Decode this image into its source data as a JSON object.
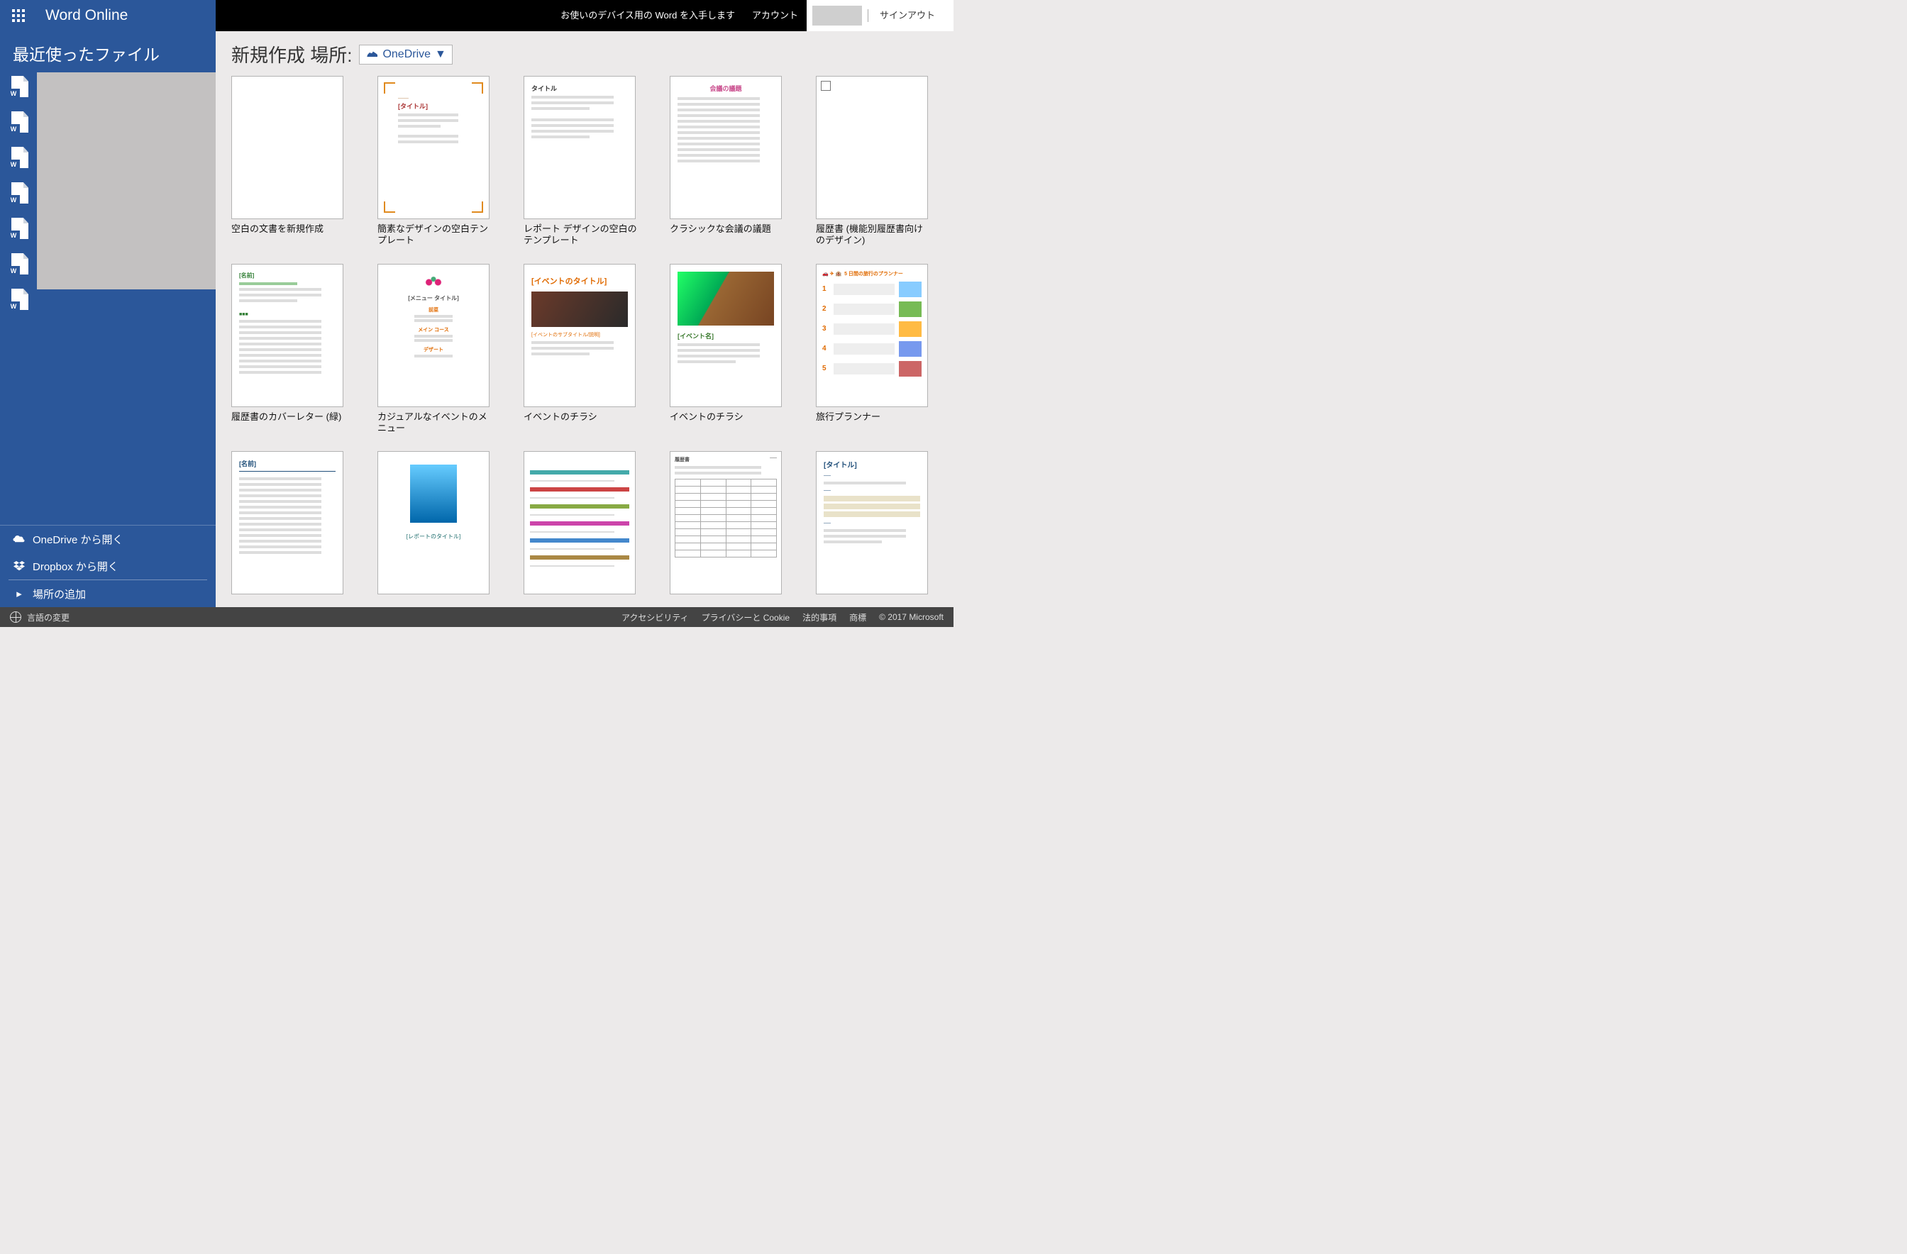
{
  "header": {
    "brand": "Word Online",
    "get_word": "お使いのデバイス用の Word を入手します",
    "account": "アカウント",
    "signout": "サインアウト"
  },
  "sidebar": {
    "recent_title": "最近使ったファイル",
    "recent_badge": "W",
    "recent_count": 7,
    "open_onedrive": "OneDrive から開く",
    "open_dropbox": "Dropbox から開く",
    "add_place": "場所の追加"
  },
  "main": {
    "heading_prefix": "新規作成 場所:",
    "picker_label": "OneDrive",
    "templates": [
      {
        "caption": "空白の文書を新規作成",
        "kind": "blank"
      },
      {
        "caption": "簡素なデザインの空白テンプレート",
        "kind": "simple"
      },
      {
        "caption": "レポート デザインの空白のテンプレート",
        "kind": "report"
      },
      {
        "caption": "クラシックな会議の議題",
        "kind": "meeting"
      },
      {
        "caption": "履歴書 (機能別履歴書向けのデザイン)",
        "kind": "resume"
      },
      {
        "caption": "履歴書のカバーレター (緑)",
        "kind": "cover"
      },
      {
        "caption": "カジュアルなイベントのメニュー",
        "kind": "menu"
      },
      {
        "caption": "イベントのチラシ",
        "kind": "flyer1"
      },
      {
        "caption": "イベントのチラシ",
        "kind": "flyer2"
      },
      {
        "caption": "旅行プランナー",
        "kind": "trip"
      },
      {
        "caption": "",
        "kind": "r11"
      },
      {
        "caption": "",
        "kind": "r12"
      },
      {
        "caption": "",
        "kind": "r13"
      },
      {
        "caption": "",
        "kind": "r14"
      },
      {
        "caption": "",
        "kind": "r15"
      }
    ]
  },
  "thumb_text": {
    "simple_title": "[タイトル]",
    "report_title": "タイトル",
    "meeting_title": "会議の議題",
    "cover_name": "[名前]",
    "menu_title": "[メニュー タイトル]",
    "menu_appetizer": "前菜",
    "menu_main": "メイン コース",
    "menu_dessert": "デザート",
    "flyer1_title": "[イベントのタイトル]",
    "flyer1_sub": "[イベントのサブタイトル/説明]",
    "flyer2_event": "[イベント名]",
    "trip_title": "5 日間の旅行のプランナー",
    "r11_name": "[名前]",
    "r12_title": "[レポートのタイトル]",
    "r14_title": "履歴書",
    "r15_title": "[タイトル]"
  },
  "footer": {
    "language": "言語の変更",
    "links": [
      "アクセシビリティ",
      "プライバシーと Cookie",
      "法的事項",
      "商標"
    ],
    "copyright": "© 2017 Microsoft"
  },
  "colors": {
    "word_blue": "#2b579a",
    "accent_orange": "#e06a00",
    "accent_green": "#2e7d32",
    "accent_pink": "#c94b8c"
  }
}
